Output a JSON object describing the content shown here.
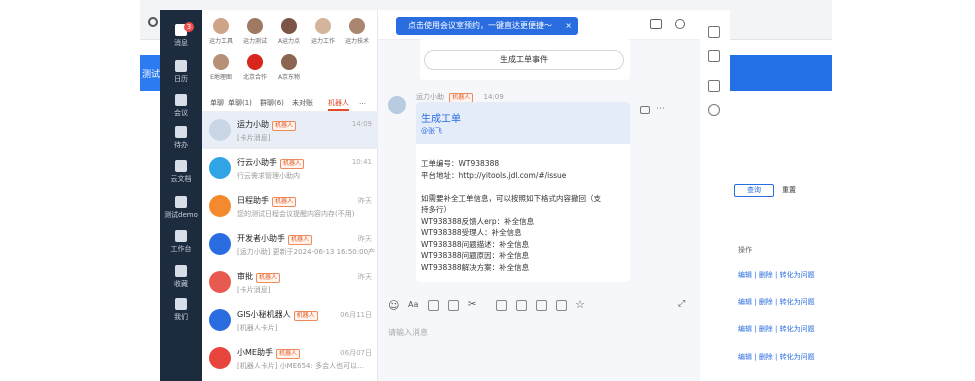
{
  "banner": {
    "text": "点击使用会议室预约，一键直达更便捷～",
    "close": "×"
  },
  "rail": [
    {
      "label": "消息",
      "badge": "3"
    },
    {
      "label": "日历"
    },
    {
      "label": "会议"
    },
    {
      "label": "待办"
    },
    {
      "label": "云文档"
    },
    {
      "label": "测试demo"
    },
    {
      "label": "工作台"
    },
    {
      "label": "收藏"
    },
    {
      "label": "我们"
    }
  ],
  "group_members": [
    "运力工具",
    "运力测试",
    "A运力点",
    "运力工作",
    "运力技术",
    "E地理图",
    "北京合作",
    "A京东物"
  ],
  "tabs": [
    {
      "label": "单聊",
      "active": false
    },
    {
      "label": "单聊(1)",
      "active": false
    },
    {
      "label": "群聊(6)",
      "active": false
    },
    {
      "label": "未对账",
      "active": false
    },
    {
      "label": "机器人",
      "active": true
    },
    {
      "label": "…",
      "active": false
    }
  ],
  "conversations": [
    {
      "name": "运力小助",
      "tag": "机器人",
      "sub": "[卡片消息]",
      "time": "14:09",
      "color": "#c9d6e6",
      "active": true
    },
    {
      "name": "行云小助手",
      "tag": "机器人",
      "sub": "行云需求管理小助内",
      "time": "10:41",
      "color": "#2fa5e8",
      "active": false
    },
    {
      "name": "日程助手",
      "tag": "机器人",
      "sub": "您的测试日程会议提醒内容内存(不用)",
      "time": "昨天",
      "color": "#f38b2e",
      "active": false
    },
    {
      "name": "开发者小助手",
      "tag": "机器人",
      "sub": "[运力小助] 更新于2024-06-13 16:50:00产…",
      "time": "昨天",
      "color": "#2a6de0",
      "active": false
    },
    {
      "name": "审批",
      "tag": "机器人",
      "sub": "[卡片消息]",
      "time": "昨天",
      "color": "#e85a4f",
      "active": false
    },
    {
      "name": "GIS小秘机器人",
      "tag": "机器人",
      "sub": "[机器人卡片]",
      "time": "06月11日",
      "color": "#2a6de0",
      "active": false
    },
    {
      "name": "小ME助手",
      "tag": "机器人",
      "sub": "[机器人卡片] 小ME654: 多会人也可以…",
      "time": "06月07日",
      "color": "#e8453c",
      "active": false
    }
  ],
  "chat": {
    "top_button": "生成工单事件",
    "sender": "运力小助",
    "sender_tag": "机器人",
    "time": "14:09",
    "card_title": "生成工单",
    "card_at": "@张飞",
    "lines": [
      "工单编号：WT938388",
      "平台地址：http://yitools.jdl.com/#/issue",
      "",
      "如需要补全工单信息，可以按照如下格式内容撤回（支",
      "持多行）",
      "WT938388反馈人erp：补全信息",
      "WT938388受理人：补全信息",
      "WT938388问题描述：补全信息",
      "WT938388问题原因：补全信息",
      "WT938388解决方案：补全信息"
    ],
    "placeholder": "请输入消息"
  },
  "bg": {
    "left_title": "测试",
    "right_actions": [
      "编辑",
      "删除",
      "转化为问题"
    ],
    "query_btn": "查询",
    "reset_btn": "重置",
    "op_header": "操作"
  }
}
